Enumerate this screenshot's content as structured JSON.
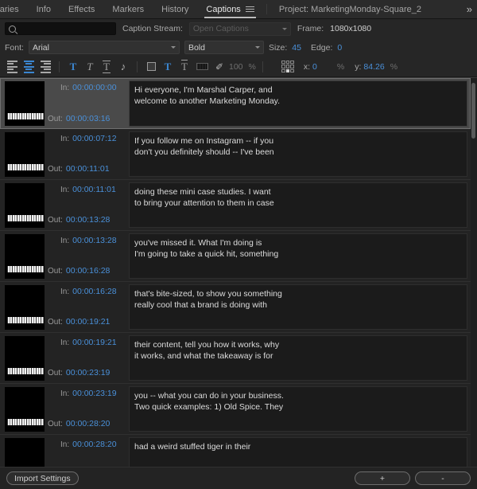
{
  "tabs": [
    {
      "label": "braries",
      "active": false,
      "name": "tab-libraries"
    },
    {
      "label": "Info",
      "active": false,
      "name": "tab-info"
    },
    {
      "label": "Effects",
      "active": false,
      "name": "tab-effects"
    },
    {
      "label": "Markers",
      "active": false,
      "name": "tab-markers"
    },
    {
      "label": "History",
      "active": false,
      "name": "tab-history"
    },
    {
      "label": "Captions",
      "active": true,
      "name": "tab-captions"
    }
  ],
  "project_tab": "Project: MarketingMonday-Square_2",
  "overflow_label": "»",
  "search": {
    "value": "",
    "placeholder": ""
  },
  "caption_stream": {
    "label": "Caption Stream:",
    "value": "Open Captions"
  },
  "frame": {
    "label": "Frame:",
    "value": "1080x1080"
  },
  "font": {
    "label": "Font:",
    "family": "Arial",
    "style": "Bold",
    "size_label": "Size:",
    "size_value": "45",
    "edge_label": "Edge:",
    "edge_value": "0"
  },
  "toolbar": {
    "opacity_value": "100",
    "opacity_unit": "%",
    "x_label": "x:",
    "x_value": "0",
    "x_unit": "%",
    "y_label": "y:",
    "y_value": "84.26",
    "y_unit": "%",
    "bold_glyph": "T",
    "italic_glyph": "T",
    "underline_glyph": "T",
    "music_glyph": "♪",
    "text_color_glyph": "T",
    "edge_glyph": "T",
    "eyedropper_glyph": "✐"
  },
  "captions": [
    {
      "in_label": "In:",
      "in": "00:00:00:00",
      "out_label": "Out:",
      "out": "00:00:03:16",
      "text": "Hi everyone, I'm Marshal Carper, and\nwelcome to another Marketing Monday.",
      "selected": true
    },
    {
      "in_label": "In:",
      "in": "00:00:07:12",
      "out_label": "Out:",
      "out": "00:00:11:01",
      "text": "If you follow me on Instagram -- if you\ndon't you definitely should -- I've been",
      "selected": false
    },
    {
      "in_label": "In:",
      "in": "00:00:11:01",
      "out_label": "Out:",
      "out": "00:00:13:28",
      "text": "doing these mini case studies. I want\nto bring your attention to them in case",
      "selected": false
    },
    {
      "in_label": "In:",
      "in": "00:00:13:28",
      "out_label": "Out:",
      "out": "00:00:16:28",
      "text": "you've missed it. What I'm doing is\nI'm going to take a quick hit, something",
      "selected": false
    },
    {
      "in_label": "In:",
      "in": "00:00:16:28",
      "out_label": "Out:",
      "out": "00:00:19:21",
      "text": "that's bite-sized, to show you something\nreally cool that a brand is doing with",
      "selected": false
    },
    {
      "in_label": "In:",
      "in": "00:00:19:21",
      "out_label": "Out:",
      "out": "00:00:23:19",
      "text": "their content, tell you how it works, why\nit works, and what the takeaway is for",
      "selected": false
    },
    {
      "in_label": "In:",
      "in": "00:00:23:19",
      "out_label": "Out:",
      "out": "00:00:28:20",
      "text": "you -- what you can do in your business.\nTwo quick examples: 1) Old Spice. They",
      "selected": false
    },
    {
      "in_label": "In:",
      "in": "00:00:28:20",
      "out_label": "Out:",
      "out": "",
      "text": "had a weird stuffed tiger in their",
      "selected": false
    }
  ],
  "bottom": {
    "import_settings": "Import Settings",
    "add": "+",
    "remove": "-"
  },
  "colors": {
    "accent_blue": "#4a90d9",
    "panel_bg": "#232323",
    "row_selected": "#4a4a4a"
  }
}
